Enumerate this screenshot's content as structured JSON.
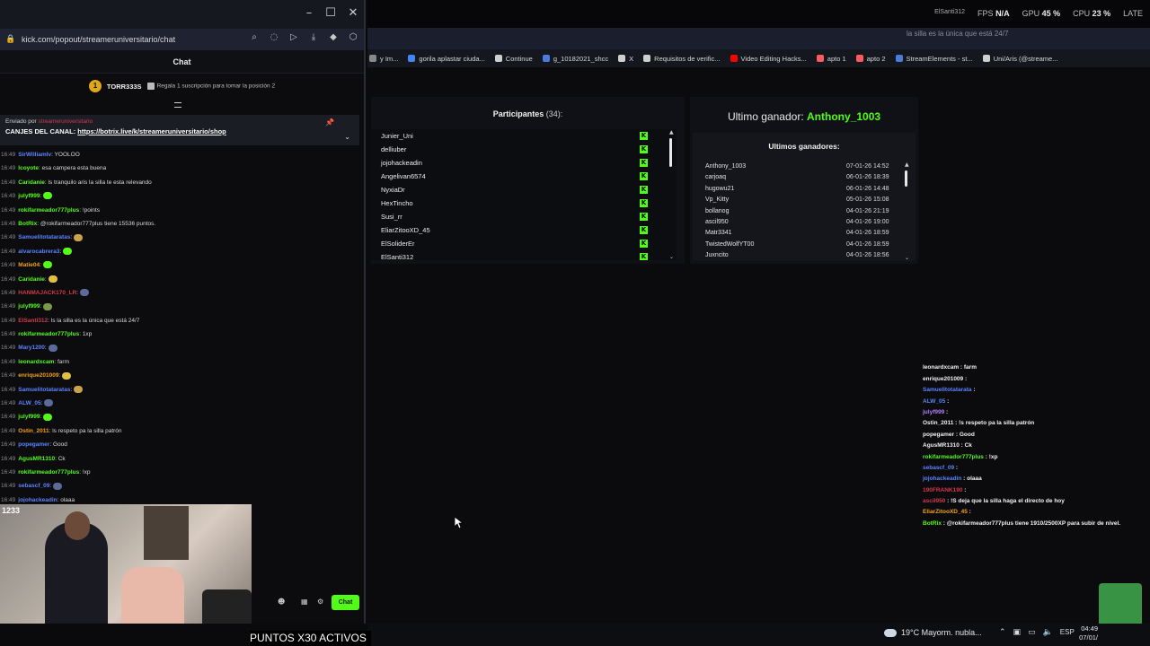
{
  "left_window": {
    "minimize": "–",
    "maximize": "☐",
    "close": "✕",
    "url": "kick.com/popout/streameruniversitario/chat",
    "chat_header": "Chat",
    "top_gifter": {
      "rank": "1",
      "name": "TORR333S",
      "note": "Regala 1 suscripción para tomar la posición 2"
    },
    "pinned": {
      "by_label": "Enviado por",
      "by_user": "streameruniversitario",
      "prefix": "CANJES DEL CANAL:",
      "link": "https://botrix.live/k/streameruniversitario/shop"
    },
    "messages": [
      {
        "time": "16:49",
        "user": "SirWilliamlv",
        "color": "#5b84ff",
        "text": ": YOOLOO",
        "emote": ""
      },
      {
        "time": "16:49",
        "user": "Icoyote",
        "color": "#53fc18",
        "text": ": esa campera esta buena",
        "emote": ""
      },
      {
        "time": "16:49",
        "user": "Caridanie",
        "color": "#53fc18",
        "text": ": ls tranquilo aris la silla te esta relevando",
        "emote": ""
      },
      {
        "time": "16:49",
        "user": "julyf999",
        "color": "#53fc18",
        "text": ":",
        "emote": "#53fc18"
      },
      {
        "time": "16:49",
        "user": "rokifarmeador777plus",
        "color": "#53fc18",
        "text": ": !points",
        "emote": ""
      },
      {
        "time": "16:49",
        "user": "BotRix",
        "color": "#53fc18",
        "text": ": @rokifarmeador777plus tiene 15536 puntos.",
        "emote": ""
      },
      {
        "time": "16:49",
        "user": "Samuelitotataratas",
        "color": "#5b84ff",
        "text": ":",
        "emote": "#c9a24a"
      },
      {
        "time": "16:49",
        "user": "alvarocabrera3",
        "color": "#5b84ff",
        "text": ":",
        "emote": "#53fc18"
      },
      {
        "time": "16:49",
        "user": "Matie04",
        "color": "#f1a11b",
        "text": ":",
        "emote": "#53fc18"
      },
      {
        "time": "16:49",
        "user": "Caridanie",
        "color": "#53fc18",
        "text": ":",
        "emote": "#e0c040"
      },
      {
        "time": "16:49",
        "user": "HANMAJACK170_LR",
        "color": "#d2384b",
        "text": ":",
        "emote": "#5a6a9a"
      },
      {
        "time": "16:49",
        "user": "julyf999",
        "color": "#53fc18",
        "text": ":",
        "emote": "#7a9a4a"
      },
      {
        "time": "16:49",
        "user": "ElSanti312",
        "color": "#d2384b",
        "text": ": ls la silla es la única que está 24/7",
        "emote": ""
      },
      {
        "time": "16:49",
        "user": "rokifarmeador777plus",
        "color": "#53fc18",
        "text": ": 1xp",
        "emote": ""
      },
      {
        "time": "16:49",
        "user": "Mary1200",
        "color": "#5b84ff",
        "text": ":",
        "emote": "#5a6a9a"
      },
      {
        "time": "16:49",
        "user": "leonardxcam",
        "color": "#53fc18",
        "text": ": farm",
        "emote": ""
      },
      {
        "time": "16:49",
        "user": "enrique201009",
        "color": "#f1a11b",
        "text": ":",
        "emote": "#e0c040"
      },
      {
        "time": "16:49",
        "user": "Samuelitotataratas",
        "color": "#5b84ff",
        "text": ":",
        "emote": "#c9a24a"
      },
      {
        "time": "16:49",
        "user": "ALW_05",
        "color": "#5b84ff",
        "text": ":",
        "emote": "#5a6a9a"
      },
      {
        "time": "16:49",
        "user": "julyf999",
        "color": "#53fc18",
        "text": ":",
        "emote": "#53fc18"
      },
      {
        "time": "16:49",
        "user": "Ostin_2011",
        "color": "#f1a11b",
        "text": ": ls respeto pa la silla patrón",
        "emote": ""
      },
      {
        "time": "16:49",
        "user": "popegamer",
        "color": "#5b84ff",
        "text": ": Good",
        "emote": ""
      },
      {
        "time": "16:49",
        "user": "AgusMR1310",
        "color": "#53fc18",
        "text": ": Ck",
        "emote": ""
      },
      {
        "time": "16:49",
        "user": "rokifarmeador777plus",
        "color": "#53fc18",
        "text": ": !xp",
        "emote": ""
      },
      {
        "time": "16:49",
        "user": "sebascf_09",
        "color": "#5b84ff",
        "text": ":",
        "emote": "#5a6a9a"
      },
      {
        "time": "16:49",
        "user": "jojohackeadin",
        "color": "#5b84ff",
        "text": ": olaaa",
        "emote": ""
      }
    ],
    "send_label": "Chat",
    "cam_logo": "1233",
    "ticker": "PUNTOS X30 ACTIVOS"
  },
  "topbar": {
    "user": "ElSanti312",
    "fps_label": "FPS",
    "fps_value": "N/A",
    "gpu_label": "GPU",
    "gpu_value": "45 %",
    "cpu_label": "CPU",
    "cpu_value": "23 %",
    "lat_label": "LATE"
  },
  "browser": {
    "ghost_text": "la silla es la única que está 24/7",
    "bookmarks": [
      {
        "label": "y Im...",
        "color": "#888888"
      },
      {
        "label": "gorila aplastar ciuda...",
        "color": "#4285f4"
      },
      {
        "label": "Continue",
        "color": "#cfcfcf"
      },
      {
        "label": "X",
        "color": "#cfcfcf"
      },
      {
        "label": "Requisitos de verific...",
        "color": "#cfcfcf"
      },
      {
        "label": "Video Editing Hacks...",
        "color": "#ff0000"
      },
      {
        "label": "apto 1",
        "color": "#ff5a5f"
      },
      {
        "label": "apto 2",
        "color": "#ff5a5f"
      },
      {
        "label": "StreamElements - st...",
        "color": "#4a7bd6"
      },
      {
        "label": "Uni/Aris (@streame...",
        "color": "#cfcfcf"
      }
    ],
    "g_bookmark": "g_10182021_shcc"
  },
  "participants": {
    "title": "Participantes",
    "count": "(34):",
    "names": [
      "Junier_Uni",
      "delliuber",
      "jojohackeadin",
      "Angelivan6574",
      "NyxiaDr",
      "HexTincho",
      "Susi_rr",
      "EliarZitooXD_45",
      "ElSoliderEr",
      "ElSanti312"
    ]
  },
  "winners": {
    "last_label": "Ultimo ganador:",
    "last_name": "Anthony_1003",
    "list_title": "Ultimos ganadores:",
    "rows": [
      {
        "name": "Anthony_1003",
        "date": "07-01-26 14:52"
      },
      {
        "name": "carjoaq",
        "date": "06-01-26 18:39"
      },
      {
        "name": "hugowu21",
        "date": "06-01-26 14:48"
      },
      {
        "name": "Vp_Kitty",
        "date": "05-01-26 15:08"
      },
      {
        "name": "bollanog",
        "date": "04-01-26 21:19"
      },
      {
        "name": "ascil950",
        "date": "04-01-26 19:00"
      },
      {
        "name": "Matr3341",
        "date": "04-01-26 18:59"
      },
      {
        "name": "TwistedWolfYT00",
        "date": "04-01-26 18:59"
      },
      {
        "name": "Juxncito",
        "date": "04-01-26 18:56"
      }
    ]
  },
  "overlay_chat": [
    {
      "user": "leonardxcam",
      "color": "#f0f0f0",
      "text": " : farm"
    },
    {
      "user": "enrique201009",
      "color": "#f0f0f0",
      "text": " :"
    },
    {
      "user": "Samuelitotatarata",
      "color": "#5b84ff",
      "text": " :"
    },
    {
      "user": "ALW_05",
      "color": "#5b84ff",
      "text": " :"
    },
    {
      "user": "julyf999",
      "color": "#b57cff",
      "text": " :"
    },
    {
      "user": "Ostin_2011",
      "color": "#f0f0f0",
      "text": " : !s respeto pa la silla patrón"
    },
    {
      "user": "popegamer",
      "color": "#f0f0f0",
      "text": " : Good"
    },
    {
      "user": "AgusMR1310",
      "color": "#f0f0f0",
      "text": " : Ck"
    },
    {
      "user": "rokifarmeador777plus",
      "color": "#53fc18",
      "text": " : !xp"
    },
    {
      "user": "sebascf_09",
      "color": "#5b84ff",
      "text": " :"
    },
    {
      "user": "jojohackeadin",
      "color": "#5b84ff",
      "text": " : olaaa"
    },
    {
      "user": "190FRANK190",
      "color": "#d2384b",
      "text": " :"
    },
    {
      "user": "ascil950",
      "color": "#d2384b",
      "text": " : !S deja que la silla haga el directo de hoy"
    },
    {
      "user": "EliarZitooXD_45",
      "color": "#f1a11b",
      "text": " :"
    },
    {
      "user": "BotRix",
      "color": "#53fc18",
      "text": " : @rokifarmeador777plus tiene 1910/2500XP para subir de nivel."
    }
  ],
  "taskbar": {
    "weather": "19°C  Mayorm. nubla...",
    "lang": "ESP",
    "time": "04:49",
    "date": "07/01/"
  }
}
